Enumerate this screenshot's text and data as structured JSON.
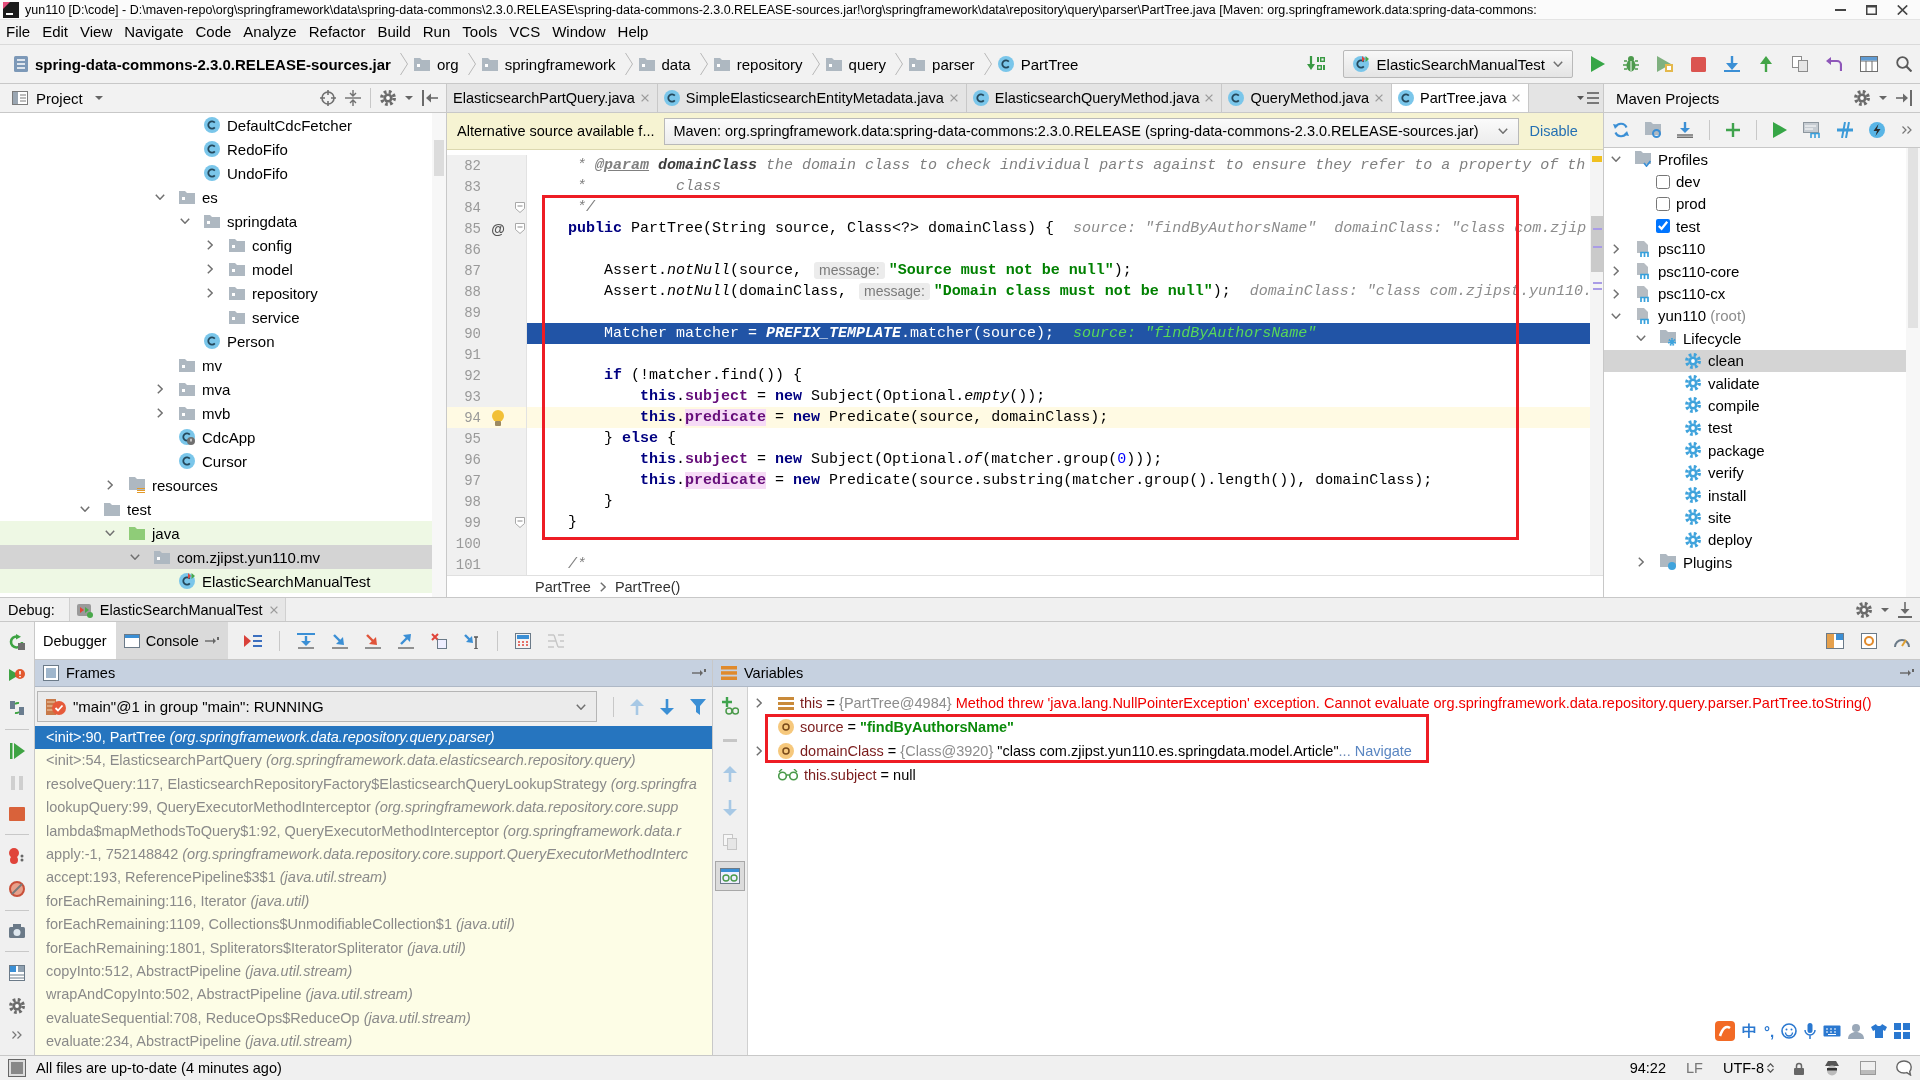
{
  "window": {
    "title": "yun110 [D:\\code] - D:\\maven-repo\\org\\springframework\\data\\spring-data-commons\\2.3.0.RELEASE\\spring-data-commons-2.3.0.RELEASE-sources.jar!\\org\\springframework\\data\\repository\\query\\parser\\PartTree.java [Maven: org.springframework.data:spring-data-commons:"
  },
  "menu": [
    "File",
    "Edit",
    "View",
    "Navigate",
    "Code",
    "Analyze",
    "Refactor",
    "Build",
    "Run",
    "Tools",
    "VCS",
    "Window",
    "Help"
  ],
  "navigation": {
    "breadcrumbs": [
      {
        "label": "spring-data-commons-2.3.0.RELEASE-sources.jar",
        "kind": "jar"
      },
      {
        "label": "org",
        "kind": "package"
      },
      {
        "label": "springframework",
        "kind": "package"
      },
      {
        "label": "data",
        "kind": "package"
      },
      {
        "label": "repository",
        "kind": "package"
      },
      {
        "label": "query",
        "kind": "package"
      },
      {
        "label": "parser",
        "kind": "package"
      },
      {
        "label": "PartTree",
        "kind": "class"
      }
    ],
    "run_config": "ElasticSearchManualTest"
  },
  "project": {
    "title": "Project",
    "tree": [
      {
        "children": [
          {
            "children": [
              {
                "children": [
                  {
                    "children": [
                      {
                        "children": [
                          {
                            "label": "DefaultCdcFetcher",
                            "kind": "class",
                            "selected": false
                          },
                          {
                            "label": "RedoFifo",
                            "kind": "class",
                            "selected": false
                          },
                          {
                            "label": "UndoFifo",
                            "kind": "class",
                            "selected": false
                          }
                        ]
                      },
                      {
                        "label": "es",
                        "kind": "package",
                        "expanded": true,
                        "selected": false,
                        "children": [
                          {
                            "label": "springdata",
                            "kind": "package",
                            "expanded": true,
                            "selected": false,
                            "children": [
                              {
                                "label": "config",
                                "kind": "package",
                                "expanded": false,
                                "selected": false
                              },
                              {
                                "label": "model",
                                "kind": "package",
                                "expanded": false,
                                "selected": false
                              },
                              {
                                "label": "repository",
                                "kind": "package",
                                "expanded": false,
                                "selected": false
                              },
                              {
                                "label": "service",
                                "kind": "package",
                                "selected": false
                              }
                            ]
                          },
                          {
                            "label": "Person",
                            "kind": "class",
                            "selected": false
                          }
                        ]
                      },
                      {
                        "label": "mv",
                        "kind": "package",
                        "selected": false
                      },
                      {
                        "label": "mva",
                        "kind": "package",
                        "expanded": false,
                        "selected": false
                      },
                      {
                        "label": "mvb",
                        "kind": "package",
                        "expanded": false,
                        "selected": false
                      },
                      {
                        "label": "CdcApp",
                        "kind": "boot-class",
                        "selected": false
                      },
                      {
                        "label": "Cursor",
                        "kind": "class",
                        "selected": false
                      }
                    ]
                  }
                ]
              },
              {
                "label": "resources",
                "kind": "resources",
                "expanded": false,
                "selected": false
              }
            ]
          },
          {
            "label": "test",
            "kind": "folder",
            "expanded": true,
            "selected": false,
            "children": [
              {
                "label": "java",
                "kind": "test-root",
                "expanded": true,
                "selected": false,
                "children": [
                  {
                    "label": "com.zjipst.yun110.mv",
                    "kind": "package",
                    "expanded": true,
                    "selected": true,
                    "children": [
                      {
                        "label": "ElasticSearchManualTest",
                        "kind": "test-class",
                        "selected": false
                      }
                    ]
                  }
                ]
              }
            ]
          }
        ]
      }
    ]
  },
  "editor": {
    "tabs": [
      {
        "label": "ElasticsearchPartQuery.java",
        "kind": "plain",
        "selected": false
      },
      {
        "label": "SimpleElasticsearchEntityMetadata.java",
        "kind": "class",
        "selected": false
      },
      {
        "label": "ElasticsearchQueryMethod.java",
        "kind": "class",
        "selected": false
      },
      {
        "label": "QueryMethod.java",
        "kind": "class",
        "selected": false
      },
      {
        "label": "PartTree.java",
        "kind": "class",
        "selected": true
      }
    ],
    "notice": {
      "text": "Alternative source available f...",
      "source": "Maven: org.springframework.data:spring-data-commons:2.3.0.RELEASE (spring-data-commons-2.3.0.RELEASE-sources.jar)",
      "action": "Disable"
    },
    "lines": [
      {
        "n": "82",
        "kind": "plain",
        "fold": false,
        "bulb": false,
        "tokens": [
          {
            "kind": "comment",
            "text": "     * "
          },
          {
            "kind": "doctag",
            "text": "@param"
          },
          {
            "kind": "docparam",
            "text": " domainClass"
          },
          {
            "kind": "comment",
            "text": " the domain class to check individual parts against to ensure they refer to a property of th"
          }
        ]
      },
      {
        "n": "83",
        "kind": "plain",
        "fold": false,
        "bulb": false,
        "tokens": [
          {
            "kind": "comment",
            "text": "     *          class"
          }
        ]
      },
      {
        "n": "84",
        "kind": "plain",
        "fold": true,
        "bulb": false,
        "tokens": [
          {
            "kind": "comment",
            "text": "     */"
          }
        ]
      },
      {
        "n": "85",
        "kind": "plain",
        "fold": true,
        "bulb": false,
        "marker": "@",
        "tokens": [
          {
            "kind": "keyword",
            "text": "    public"
          },
          {
            "kind": "plain",
            "text": " PartTree(String source, Class<?> domainClass) {"
          },
          {
            "kind": "debug",
            "text": "source: \"findByAuthorsName\"  domainClass: \"class com.zjip"
          }
        ]
      },
      {
        "n": "86",
        "kind": "plain",
        "fold": false,
        "bulb": false
      },
      {
        "n": "87",
        "kind": "plain",
        "fold": false,
        "bulb": false,
        "tokens": [
          {
            "kind": "plain",
            "text": "        Assert."
          },
          {
            "kind": "static",
            "text": "notNull"
          },
          {
            "kind": "plain",
            "text": "(source, "
          },
          {
            "kind": "hint",
            "text": "message:"
          },
          {
            "kind": "string",
            "text": "\"Source must not be null\""
          },
          {
            "kind": "plain",
            "text": ");"
          }
        ]
      },
      {
        "n": "88",
        "kind": "plain",
        "fold": false,
        "bulb": false,
        "tokens": [
          {
            "kind": "plain",
            "text": "        Assert."
          },
          {
            "kind": "static",
            "text": "notNull"
          },
          {
            "kind": "plain",
            "text": "(domainClass, "
          },
          {
            "kind": "hint",
            "text": "message:"
          },
          {
            "kind": "string",
            "text": "\"Domain class must not be null\""
          },
          {
            "kind": "plain",
            "text": ");"
          },
          {
            "kind": "debug",
            "text": "domainClass: \"class com.zjipst.yun110."
          }
        ]
      },
      {
        "n": "89",
        "kind": "plain",
        "fold": false,
        "bulb": false
      },
      {
        "n": "90",
        "kind": "execution",
        "fold": false,
        "bulb": false,
        "tokens": [
          {
            "kind": "plain",
            "text": "        Matcher matcher = "
          },
          {
            "kind": "constant",
            "text": "PREFIX_TEMPLATE"
          },
          {
            "kind": "plain",
            "text": ".matcher(source);"
          },
          {
            "kind": "debug",
            "text": "source: \"findByAuthorsName\""
          }
        ]
      },
      {
        "n": "91",
        "kind": "plain",
        "fold": false,
        "bulb": false
      },
      {
        "n": "92",
        "kind": "plain",
        "fold": false,
        "bulb": false,
        "tokens": [
          {
            "kind": "keyword",
            "text": "        if"
          },
          {
            "kind": "plain",
            "text": " (!matcher.find()) {"
          }
        ]
      },
      {
        "n": "93",
        "kind": "plain",
        "fold": false,
        "bulb": false,
        "tokens": [
          {
            "kind": "keyword",
            "text": "            this"
          },
          {
            "kind": "plain",
            "text": "."
          },
          {
            "kind": "field",
            "text": "subject"
          },
          {
            "kind": "plain",
            "text": " = "
          },
          {
            "kind": "keyword",
            "text": "new"
          },
          {
            "kind": "plain",
            "text": " Subject(Optional."
          },
          {
            "kind": "static",
            "text": "empty"
          },
          {
            "kind": "plain",
            "text": "());"
          }
        ]
      },
      {
        "n": "94",
        "kind": "caret",
        "fold": false,
        "bulb": true,
        "tokens": [
          {
            "kind": "keyword",
            "text": "            this"
          },
          {
            "kind": "plain",
            "text": "."
          },
          {
            "kind": "usage",
            "text": "predicate"
          },
          {
            "kind": "plain",
            "text": " = "
          },
          {
            "kind": "keyword",
            "text": "new"
          },
          {
            "kind": "plain",
            "text": " Predicate(source, domainClass);"
          }
        ]
      },
      {
        "n": "95",
        "kind": "plain",
        "fold": false,
        "bulb": false,
        "tokens": [
          {
            "kind": "plain",
            "text": "        } "
          },
          {
            "kind": "keyword",
            "text": "else"
          },
          {
            "kind": "plain",
            "text": " {"
          }
        ]
      },
      {
        "n": "96",
        "kind": "plain",
        "fold": false,
        "bulb": false,
        "tokens": [
          {
            "kind": "keyword",
            "text": "            this"
          },
          {
            "kind": "plain",
            "text": "."
          },
          {
            "kind": "field",
            "text": "subject"
          },
          {
            "kind": "plain",
            "text": " = "
          },
          {
            "kind": "keyword",
            "text": "new"
          },
          {
            "kind": "plain",
            "text": " Subject(Optional."
          },
          {
            "kind": "static",
            "text": "of"
          },
          {
            "kind": "plain",
            "text": "(matcher.group("
          },
          {
            "kind": "number",
            "text": "0"
          },
          {
            "kind": "plain",
            "text": ")));"
          }
        ]
      },
      {
        "n": "97",
        "kind": "plain",
        "fold": false,
        "bulb": false,
        "tokens": [
          {
            "kind": "keyword",
            "text": "            this"
          },
          {
            "kind": "plain",
            "text": "."
          },
          {
            "kind": "usage",
            "text": "predicate"
          },
          {
            "kind": "plain",
            "text": " = "
          },
          {
            "kind": "keyword",
            "text": "new"
          },
          {
            "kind": "plain",
            "text": " Predicate(source.substring(matcher.group().length()), domainClass);"
          }
        ]
      },
      {
        "n": "98",
        "kind": "plain",
        "fold": false,
        "bulb": false,
        "tokens": [
          {
            "kind": "plain",
            "text": "        }"
          }
        ]
      },
      {
        "n": "99",
        "kind": "plain",
        "fold": true,
        "bulb": false,
        "tokens": [
          {
            "kind": "plain",
            "text": "    }"
          }
        ]
      },
      {
        "n": "100",
        "kind": "plain",
        "fold": false,
        "bulb": false
      },
      {
        "n": "101",
        "kind": "plain",
        "fold": false,
        "bulb": false,
        "tokens": [
          {
            "kind": "comment",
            "text": "    /*"
          }
        ]
      }
    ],
    "breadcrumbs": [
      "PartTree",
      "PartTree()"
    ]
  },
  "maven": {
    "title": "Maven Projects",
    "tree": [
      {
        "label": "Profiles",
        "kind": "profiles",
        "expanded": true,
        "selected": false,
        "children": [
          {
            "label": "dev",
            "kind": "profile",
            "checked": false
          },
          {
            "label": "prod",
            "kind": "profile",
            "checked": false
          },
          {
            "label": "test",
            "kind": "profile",
            "checked": true
          }
        ]
      },
      {
        "label": "psc110",
        "kind": "module",
        "expanded": false,
        "selected": false
      },
      {
        "label": "psc110-core",
        "kind": "module",
        "expanded": false,
        "selected": false
      },
      {
        "label": "psc110-cx",
        "kind": "module",
        "expanded": false,
        "selected": false
      },
      {
        "label": "yun110",
        "note": "(root)",
        "kind": "module",
        "expanded": true,
        "selected": false,
        "children": [
          {
            "label": "Lifecycle",
            "kind": "lifecycle",
            "expanded": true,
            "selected": false,
            "children": [
              {
                "label": "clean",
                "kind": "goal",
                "selected": true
              },
              {
                "label": "validate",
                "kind": "goal",
                "selected": false
              },
              {
                "label": "compile",
                "kind": "goal",
                "selected": false
              },
              {
                "label": "test",
                "kind": "goal",
                "selected": false
              },
              {
                "label": "package",
                "kind": "goal",
                "selected": false
              },
              {
                "label": "verify",
                "kind": "goal",
                "selected": false
              },
              {
                "label": "install",
                "kind": "goal",
                "selected": false
              },
              {
                "label": "site",
                "kind": "goal",
                "selected": false
              },
              {
                "label": "deploy",
                "kind": "goal",
                "selected": false
              }
            ]
          },
          {
            "label": "Plugins",
            "kind": "plugins",
            "expanded": false,
            "selected": false
          }
        ]
      }
    ]
  },
  "debug": {
    "label": "Debug:",
    "session": "ElasticSearchManualTest",
    "side_toolbar": [
      {
        "kind": "rerun",
        "disabled": false
      },
      {
        "kind": "rerun-failed",
        "disabled": false
      },
      {
        "kind": "restart",
        "disabled": false
      },
      {
        "kind": "resume",
        "disabled": false
      },
      {
        "kind": "pause",
        "disabled": true
      },
      {
        "kind": "stop",
        "disabled": false
      },
      {
        "kind": "breakpoints",
        "disabled": false
      },
      {
        "kind": "mute",
        "disabled": false
      },
      {
        "kind": "dump",
        "disabled": false
      },
      {
        "kind": "layout",
        "disabled": false
      },
      {
        "kind": "settings",
        "disabled": false
      },
      {
        "kind": "more",
        "disabled": false
      }
    ],
    "tabs": [
      {
        "label": "Debugger",
        "kind": "plain",
        "selected": true
      },
      {
        "label": "Console",
        "kind": "console",
        "selected": false
      }
    ],
    "toolbar": [
      {
        "kind": "execution-point",
        "disabled": false
      },
      {
        "kind": "step-over",
        "disabled": false
      },
      {
        "kind": "step-into",
        "disabled": false
      },
      {
        "kind": "force-step-into",
        "disabled": false
      },
      {
        "kind": "step-out",
        "disabled": false
      },
      {
        "kind": "drop-frame",
        "disabled": false
      },
      {
        "kind": "run-to-cursor",
        "disabled": false
      },
      {
        "kind": "evaluate",
        "disabled": false
      },
      {
        "kind": "trace",
        "disabled": true
      }
    ],
    "frames": {
      "title": "Frames",
      "thread": "\"main\"@1 in group \"main\": RUNNING",
      "nav": [
        {
          "kind": "up",
          "disabled": true
        },
        {
          "kind": "down",
          "disabled": false
        },
        {
          "kind": "filter",
          "disabled": false
        }
      ],
      "items": [
        {
          "method": "<init>:90, PartTree",
          "location": "(org.springframework.data.repository.query.parser)",
          "selected": true
        },
        {
          "method": "<init>:54, ElasticsearchPartQuery",
          "location": "(org.springframework.data.elasticsearch.repository.query)",
          "selected": false
        },
        {
          "method": "resolveQuery:117, ElasticsearchRepositoryFactory$ElasticsearchQueryLookupStrategy",
          "location": "(org.springfra",
          "selected": false
        },
        {
          "method": "lookupQuery:99, QueryExecutorMethodInterceptor",
          "location": "(org.springframework.data.repository.core.supp",
          "selected": false
        },
        {
          "method": "lambda$mapMethodsToQuery$1:92, QueryExecutorMethodInterceptor",
          "location": "(org.springframework.data.r",
          "selected": false
        },
        {
          "method": "apply:-1, 752148842",
          "location": "(org.springframework.data.repository.core.support.QueryExecutorMethodInterc",
          "selected": false
        },
        {
          "method": "accept:193, ReferencePipeline$3$1",
          "location": "(java.util.stream)",
          "selected": false
        },
        {
          "method": "forEachRemaining:116, Iterator",
          "location": "(java.util)",
          "selected": false
        },
        {
          "method": "forEachRemaining:1109, Collections$UnmodifiableCollection$1",
          "location": "(java.util)",
          "selected": false
        },
        {
          "method": "forEachRemaining:1801, Spliterators$IteratorSpliterator",
          "location": "(java.util)",
          "selected": false
        },
        {
          "method": "copyInto:512, AbstractPipeline",
          "location": "(java.util.stream)",
          "selected": false
        },
        {
          "method": "wrapAndCopyInto:502, AbstractPipeline",
          "location": "(java.util.stream)",
          "selected": false
        },
        {
          "method": "evaluateSequential:708, ReduceOps$ReduceOp",
          "location": "(java.util.stream)",
          "selected": false
        },
        {
          "method": "evaluate:234, AbstractPipeline",
          "location": "(java.util.stream)",
          "selected": false
        }
      ]
    },
    "variables": {
      "title": "Variables",
      "toolbar": [
        {
          "kind": "add",
          "disabled": false,
          "on": false
        },
        {
          "kind": "remove",
          "disabled": true,
          "on": false
        },
        {
          "kind": "up",
          "disabled": true,
          "on": false
        },
        {
          "kind": "down",
          "disabled": true,
          "on": false
        },
        {
          "kind": "duplicate",
          "disabled": true,
          "on": false
        },
        {
          "kind": "watches",
          "disabled": false,
          "on": true
        }
      ],
      "items": [
        {
          "kind": "field",
          "expandable": true,
          "name": "this",
          "op": " = ",
          "ref": "{PartTree@4984}",
          "value": {
            "kind": "error",
            "text": "Method threw 'java.lang.NullPointerException' exception. Cannot evaluate org.springframework.data.repository.query.parser.PartTree.toString()"
          }
        },
        {
          "kind": "param",
          "expandable": false,
          "name": "source",
          "op": " = ",
          "value": {
            "kind": "string",
            "text": "\"findByAuthorsName\""
          }
        },
        {
          "kind": "param",
          "expandable": true,
          "name": "domainClass",
          "op": " = ",
          "ref": "{Class@3920}",
          "value": {
            "kind": "plain",
            "text": "\"class com.zjipst.yun110.es.springdata.model.Article\""
          },
          "more": "...",
          "link": "Navigate"
        },
        {
          "kind": "watch",
          "expandable": false,
          "name": "this.subject",
          "op": " = ",
          "value": {
            "kind": "plain",
            "text": "null"
          }
        }
      ]
    }
  },
  "input_method": {
    "mode": "中",
    "punctuation": "°,"
  },
  "status_bar": {
    "message": "All files are up-to-date (4 minutes ago)",
    "position": "94:22",
    "line_separator": "LF",
    "encoding": "UTF-8"
  }
}
